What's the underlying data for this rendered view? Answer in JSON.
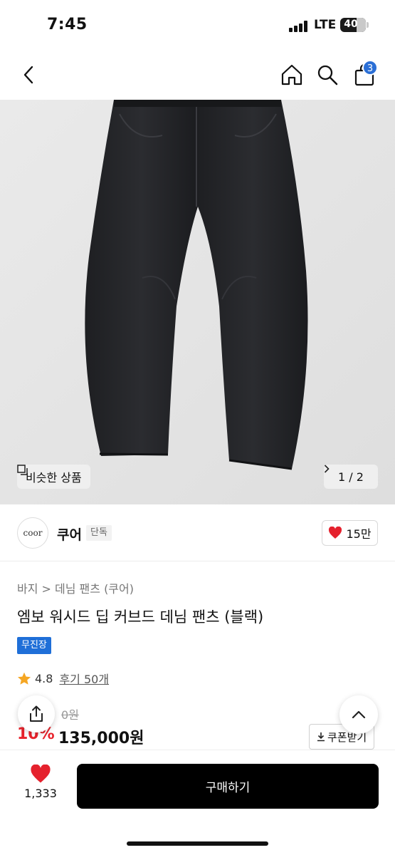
{
  "status_bar": {
    "time": "7:45",
    "network": "LTE",
    "battery": "40"
  },
  "header": {
    "cart_count": "3",
    "icons": [
      "back-icon",
      "home-icon",
      "search-icon",
      "bag-icon"
    ]
  },
  "hero": {
    "similar_label": "비슷한 상품",
    "counter": "1 / 2"
  },
  "brand": {
    "logo_text": "coor",
    "name": "쿠어",
    "exclusive_label": "단독",
    "likes": "15만"
  },
  "product": {
    "breadcrumb": "바지 > 데님 팬츠 (쿠어)",
    "title": "엠보 워시드 딥 커브드 데님 팬츠 (블랙)",
    "tag": "무진장",
    "rating": "4.8",
    "reviews": "후기 50개",
    "original_price": "0원",
    "discount": "10%",
    "price": "135,000원",
    "coupon_label": "쿠폰받기"
  },
  "bottom": {
    "wish_count": "1,333",
    "buy_label": "구매하기"
  },
  "colors": {
    "accent_blue": "#2b6fd6",
    "sale_red": "#e8232c",
    "heart_red": "#e5212d",
    "star": "#f5a623"
  }
}
